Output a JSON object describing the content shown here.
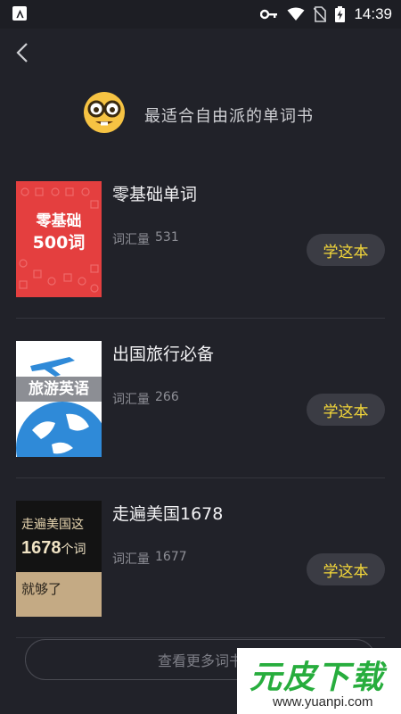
{
  "status_bar": {
    "time": "14:39",
    "icons": [
      "app-notification-icon",
      "vpn-key-icon",
      "wifi-icon",
      "no-sim-icon",
      "battery-charging-icon"
    ]
  },
  "nav": {
    "back_icon": "chevron-left-icon"
  },
  "header": {
    "emoji": "nerd-face-emoji",
    "title": "最适合自由派的单词书"
  },
  "books": [
    {
      "title": "零基础单词",
      "count_label": "词汇量",
      "count": "531",
      "button": "学这本",
      "cover": {
        "line1": "零基础",
        "line2": "500词",
        "color": "#e43f3f"
      }
    },
    {
      "title": "出国旅行必备",
      "count_label": "词汇量",
      "count": "266",
      "button": "学这本",
      "cover": {
        "band": "旅游英语",
        "color": "#2f8ad8"
      }
    },
    {
      "title": "走遍美国1678",
      "count_label": "词汇量",
      "count": "1677",
      "button": "学这本",
      "cover": {
        "line1": "走遍美国这",
        "line2_num": "1678",
        "line2_unit": "个词",
        "line3": "就够了"
      }
    }
  ],
  "more_button": "查看更多词书",
  "watermark": {
    "title": "元皮下载",
    "url": "www.yuanpi.com"
  },
  "colors": {
    "background": "#212229",
    "accent_text": "#f5d93a",
    "button_bg": "#3b3c44"
  }
}
